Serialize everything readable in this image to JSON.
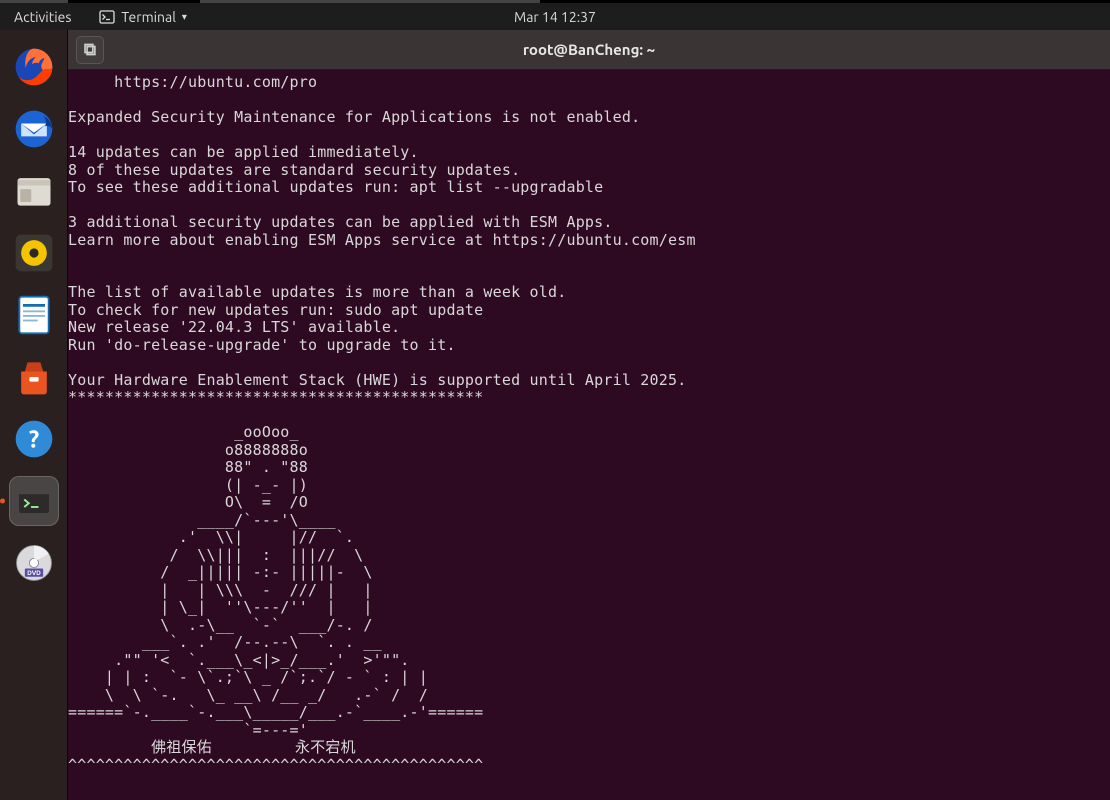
{
  "topbar": {
    "activities": "Activities",
    "app_label": "Terminal",
    "clock": "Mar 14  12:37"
  },
  "dock": {
    "items": [
      {
        "name": "firefox-icon"
      },
      {
        "name": "thunderbird-icon"
      },
      {
        "name": "files-icon"
      },
      {
        "name": "rhythmbox-icon"
      },
      {
        "name": "writer-icon"
      },
      {
        "name": "software-icon"
      },
      {
        "name": "help-icon"
      },
      {
        "name": "terminal-icon",
        "active": true
      },
      {
        "name": "disc-icon"
      }
    ]
  },
  "window": {
    "title": "root@BanCheng: ~",
    "new_tab_glyph": "⧉"
  },
  "terminal_lines": [
    "     https://ubuntu.com/pro",
    "",
    "Expanded Security Maintenance for Applications is not enabled.",
    "",
    "14 updates can be applied immediately.",
    "8 of these updates are standard security updates.",
    "To see these additional updates run: apt list --upgradable",
    "",
    "3 additional security updates can be applied with ESM Apps.",
    "Learn more about enabling ESM Apps service at https://ubuntu.com/esm",
    "",
    "",
    "The list of available updates is more than a week old.",
    "To check for new updates run: sudo apt update",
    "New release '22.04.3 LTS' available.",
    "Run 'do-release-upgrade' to upgrade to it.",
    "",
    "Your Hardware Enablement Stack (HWE) is supported until April 2025.",
    "*********************************************",
    "",
    "                  _ooOoo_",
    "                 o8888888o",
    "                 88\" . \"88",
    "                 (| -_- |)",
    "                 O\\  =  /O",
    "              ____/`---'\\____",
    "            .'  \\\\|     |//  `.",
    "           /  \\\\|||  :  |||//  \\",
    "          /  _||||| -:- |||||-  \\",
    "          |   | \\\\\\  -  /// |   |",
    "          | \\_|  ''\\---/''  |   |",
    "          \\  .-\\__  `-`  ___/-. /",
    "        ___`. .'  /--.--\\  `. . __",
    "     .\"\" '<  `.___\\_<|>_/___.'  >'\"\".",
    "    | | :  `- \\`.;`\\ _ /`;.`/ - ` : | |",
    "    \\  \\ `-.   \\_ __\\ /__ _/   .-` /  /",
    "======`-.____`-.___\\_____/___.-`____.-'======",
    "                   `=---='",
    "         佛祖保佑         永不宕机",
    "^^^^^^^^^^^^^^^^^^^^^^^^^^^^^^^^^^^^^^^^^^^^^"
  ]
}
